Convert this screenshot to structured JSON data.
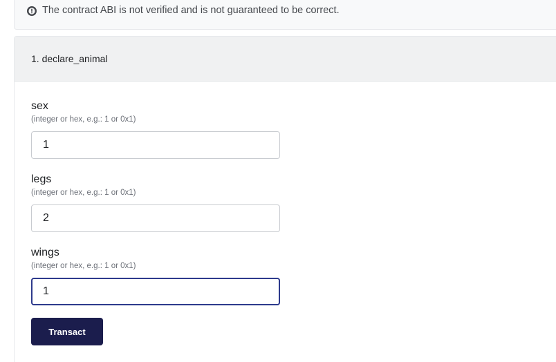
{
  "notice": {
    "icon": "alert-circle-icon",
    "text": "The contract ABI is not verified and is not guaranteed to be correct."
  },
  "method": {
    "title": "1. declare_animal",
    "fields": [
      {
        "label": "sex",
        "hint": "(integer or hex, e.g.: 1 or 0x1)",
        "value": "1"
      },
      {
        "label": "legs",
        "hint": "(integer or hex, e.g.: 1 or 0x1)",
        "value": "2"
      },
      {
        "label": "wings",
        "hint": "(integer or hex, e.g.: 1 or 0x1)",
        "value": "1"
      }
    ],
    "submit_label": "Transact"
  },
  "colors": {
    "button_bg": "#1b1d4d",
    "focus_border": "#2d3a8c"
  }
}
